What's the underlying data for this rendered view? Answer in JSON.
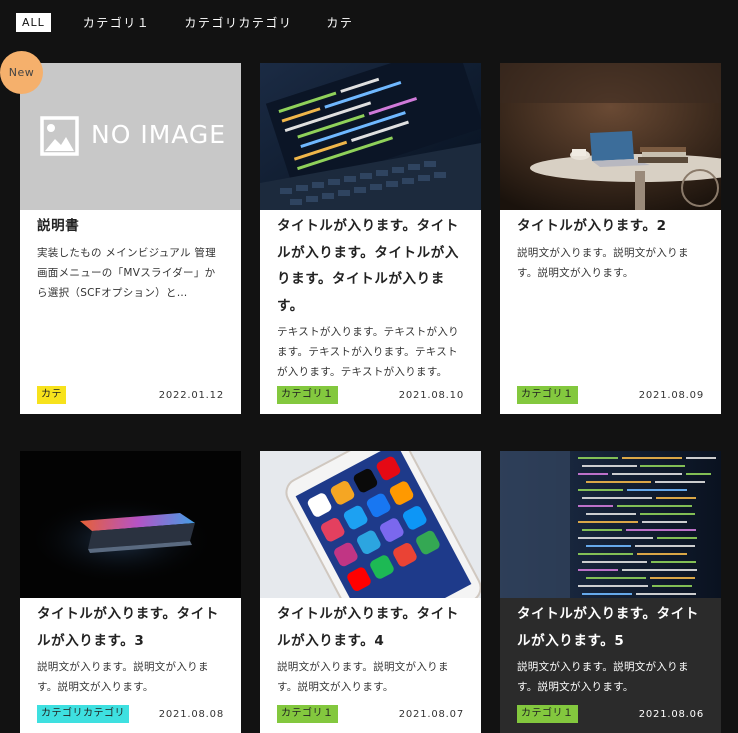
{
  "filter_tabs": [
    {
      "label": "ALL",
      "active": true
    },
    {
      "label": "カテゴリ１",
      "active": false
    },
    {
      "label": "カテゴリカテゴリ",
      "active": false
    },
    {
      "label": "カテ",
      "active": false
    }
  ],
  "new_badge": "New",
  "cards": [
    {
      "image": {
        "kind": "no-image",
        "text": "NO IMAGE"
      },
      "title": "説明書",
      "text": "実装したもの メインビジュアル 管理画面メニューの「MVスライダー」から選択（SCFオプション）と…",
      "category": "カテ",
      "category_color": "#f7e21c",
      "date": "2022.01.12"
    },
    {
      "image": {
        "kind": "laptop-code"
      },
      "title": "タイトルが入ります。タイトルが入ります。タイトルが入ります。タイトルが入ります。",
      "text": "テキストが入ります。テキストが入ります。テキストが入ります。テキストが入ります。テキストが入ります。",
      "category": "カテゴリ１",
      "category_color": "#83c83e",
      "date": "2021.08.10"
    },
    {
      "image": {
        "kind": "cafe-laptop"
      },
      "title": "タイトルが入ります。2",
      "text": "説明文が入ります。説明文が入ります。説明文が入ります。",
      "category": "カテゴリ１",
      "category_color": "#83c83e",
      "date": "2021.08.09"
    },
    {
      "image": {
        "kind": "dark-laptop"
      },
      "title": "タイトルが入ります。タイトルが入ります。3",
      "text": "説明文が入ります。説明文が入ります。説明文が入ります。",
      "category": "カテゴリカテゴリ",
      "category_color": "#3ee0e0",
      "date": "2021.08.08"
    },
    {
      "image": {
        "kind": "smartphone"
      },
      "title": "タイトルが入ります。タイトルが入ります。4",
      "text": "説明文が入ります。説明文が入ります。説明文が入ります。",
      "category": "カテゴリ１",
      "category_color": "#83c83e",
      "date": "2021.08.07"
    },
    {
      "image": {
        "kind": "code-screen"
      },
      "title": "タイトルが入ります。タイトルが入ります。5",
      "text": "説明文が入ります。説明文が入ります。説明文が入ります。",
      "category": "カテゴリ１",
      "category_color": "#83c83e",
      "date": "2021.08.06",
      "hovered": true
    }
  ]
}
